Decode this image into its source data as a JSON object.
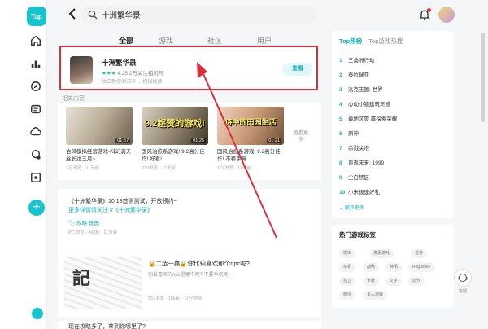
{
  "brand": {
    "logo_text": "Tap"
  },
  "search": {
    "query": "十洲繁华景"
  },
  "tabs": [
    "全部",
    "游戏",
    "社区",
    "用户"
  ],
  "game": {
    "name": "十洲繁华录",
    "meta": "4.25  2万关注相机号",
    "desc": "独立新游测试中 ... 模拟经营",
    "button": "查看"
  },
  "section_label": "相关内容",
  "videos": [
    {
      "duration": "01:57",
      "overlay": "",
      "title": "古风模拟经营游戏-科幻满天丝长达三月~",
      "meta": "2万浏览 · 11天前"
    },
    {
      "duration": "01:25",
      "overlay": "9.2超赞的游戏!",
      "title": "国风治愈系游戏! 9.2高分佳作! 好看!",
      "meta": "230浏览 · 11天前"
    },
    {
      "duration": "01:21",
      "overlay": "诗中的田园生活",
      "title": "国风治愈系游戏! 9.2高分佳作! 不释手嘛",
      "meta": "127浏览 · 11天前"
    }
  ],
  "more_label": "查看更多",
  "post1": {
    "line1": "《十洲繁华录》10.18首测测试，开放预约~",
    "line2": "更多详情请关注 #《十洲繁华录》",
    "tag": "🏷 攻略 玩图",
    "meta": "8仁浏览 · 4回复 · 11分钟"
  },
  "post2": {
    "title": "🔒二选一赢🔒你比较喜欢那个npc呢?",
    "desc": "你最喜欢的npc是哪个呢? 不要手欢呢~",
    "meta": "257浏览 · 1回复 · 11分钟前"
  },
  "post3": {
    "title": "现在攻略多了，拿到你哪里了?"
  },
  "ranking": {
    "tab1": "Top热榜",
    "tab2": "Top游戏热搜",
    "items": [
      "三角洲行动",
      "泰拉瑞亚",
      "洛克王国: 世界",
      "心动小镇建筑灵感",
      "最地区零 赢探索荣耀",
      "原神",
      "杀戮尖塔",
      "重返未来: 1999",
      "尘白禁区",
      "小米极速好礼"
    ],
    "more": "展开更多"
  },
  "hot_tags": {
    "title": "热门游戏标签",
    "tags": [
      "模拟",
      "像素游戏",
      "音游",
      "单机",
      "战略",
      "休闲",
      "Roguelike",
      "独立",
      "卡牌",
      "文字",
      "动作",
      "剧情",
      "多人游戏"
    ]
  },
  "side_button": {
    "label": "客服"
  }
}
